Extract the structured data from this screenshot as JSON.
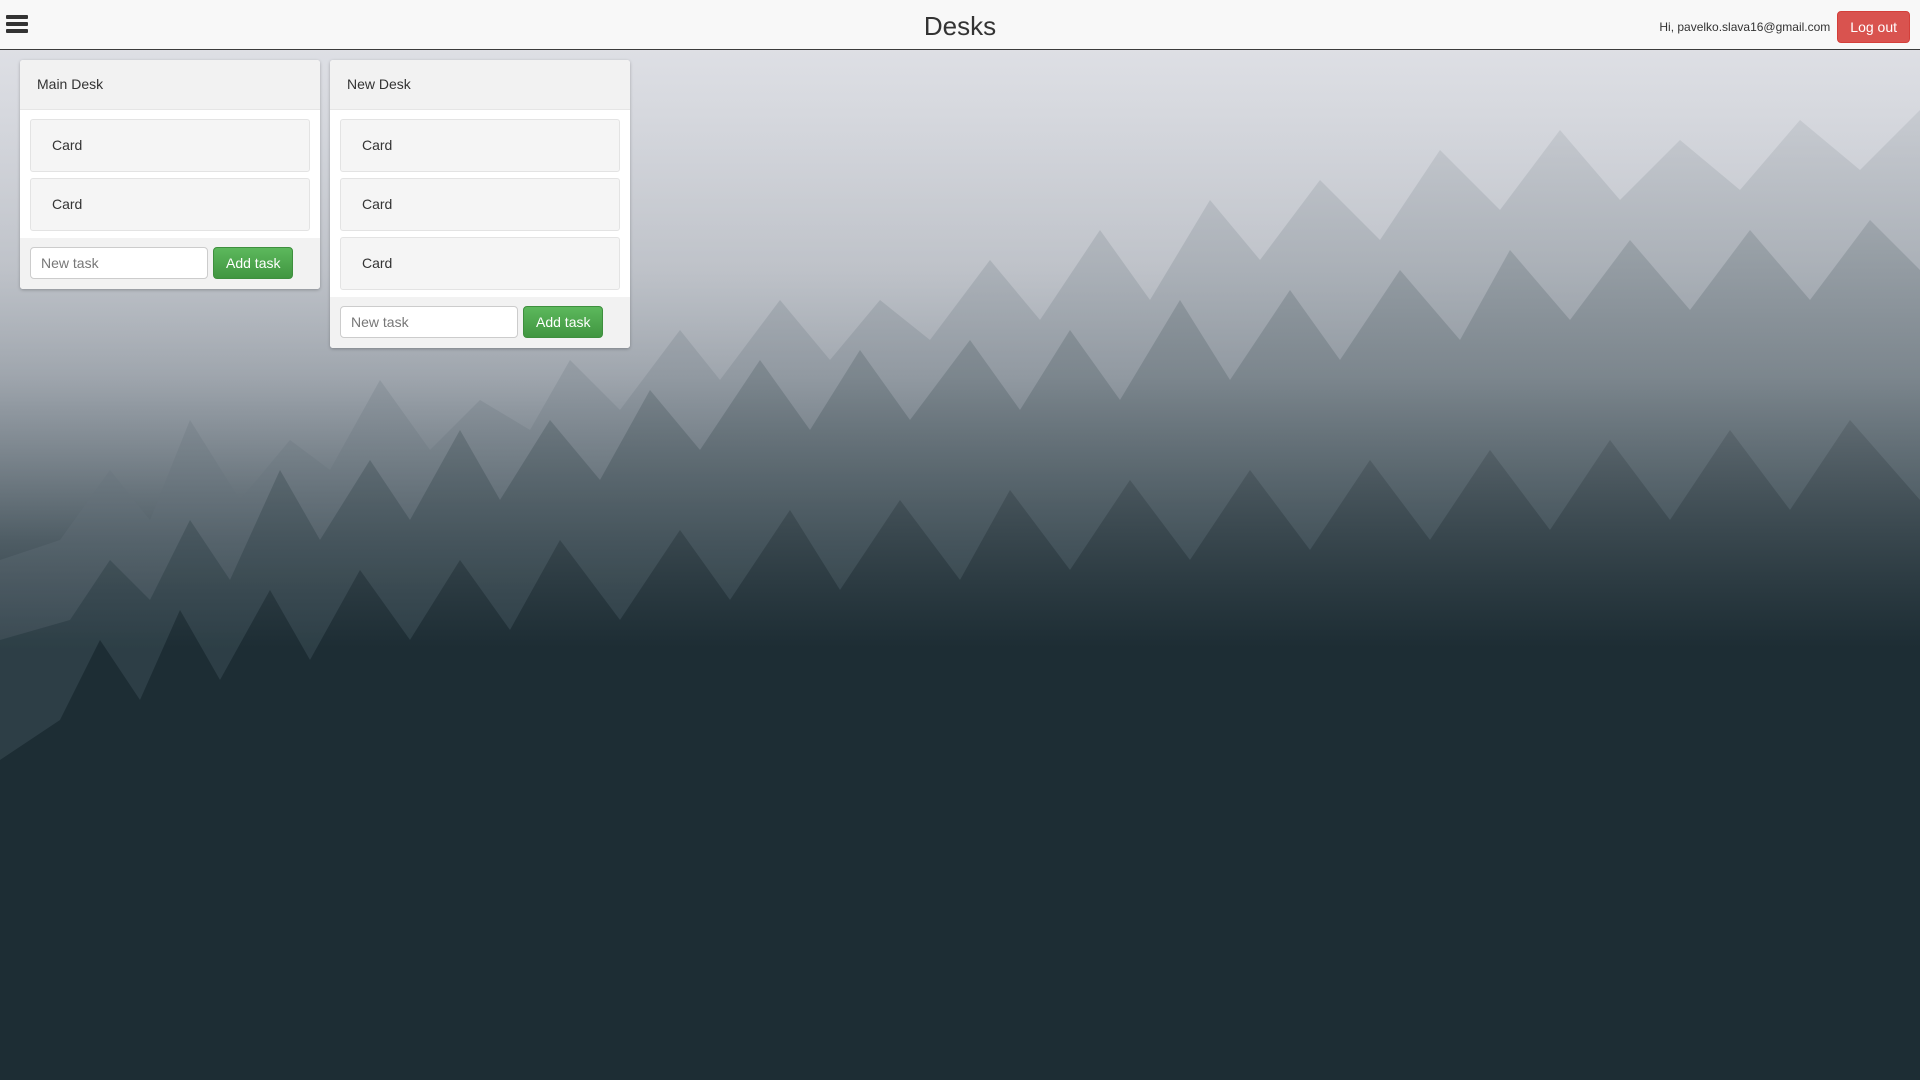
{
  "header": {
    "title": "Desks",
    "greeting": "Hi, pavelko.slava16@gmail.com",
    "logout_label": "Log out",
    "menu_icon": "hamburger-menu-icon"
  },
  "desks": [
    {
      "title": "Main Desk",
      "cards": [
        "Card",
        "Card"
      ],
      "input_placeholder": "New task",
      "add_label": "Add task"
    },
    {
      "title": "New Desk",
      "cards": [
        "Card",
        "Card",
        "Card"
      ],
      "input_placeholder": "New task",
      "add_label": "Add task"
    }
  ],
  "colors": {
    "logout": "#d9534f",
    "add_task": "#5cb85c",
    "topbar": "#f8f8f8"
  }
}
